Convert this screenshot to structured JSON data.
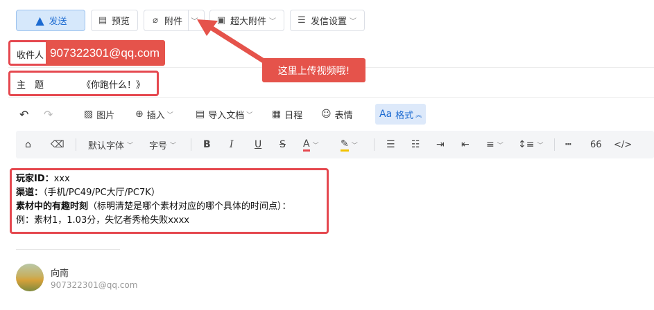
{
  "toolbar": {
    "send_label": "发送",
    "preview_label": "预览",
    "attach_label": "附件",
    "big_attach_label": "超大附件",
    "send_settings_label": "发信设置"
  },
  "recipient": {
    "label": "收件人",
    "value": "907322301@qq.com"
  },
  "subject": {
    "label": "主　题",
    "value": "《你跑什么！》"
  },
  "annotation": {
    "callout_text": "这里上传视频哦!",
    "highlight_color": "#e5484f"
  },
  "editor_toolbar": {
    "image_label": "图片",
    "insert_label": "插入",
    "import_doc_label": "导入文档",
    "schedule_label": "日程",
    "emoji_label": "表情",
    "format_label": "格式",
    "format_icon_text": "Aa",
    "font_label": "默认字体",
    "size_label": "字号",
    "quote_label": "66"
  },
  "body": {
    "line1_key": "玩家ID：",
    "line1_val": "xxx",
    "line2_key": "渠道：",
    "line2_val": "（手机/PC49/PC大厅/PC7K）",
    "line3_key": "素材中的有趣时刻",
    "line3_val": "（标明清楚是哪个素材对应的哪个具体的时间点）：",
    "line4": "例：素材1，1.03分，失忆者秀枪失败xxxx"
  },
  "signature": {
    "name": "向南",
    "email": "907322301@qq.com"
  },
  "colors": {
    "accent": "#1b6ad1",
    "send_bg": "#d6e8fb",
    "annotation_red": "#e5534b"
  }
}
